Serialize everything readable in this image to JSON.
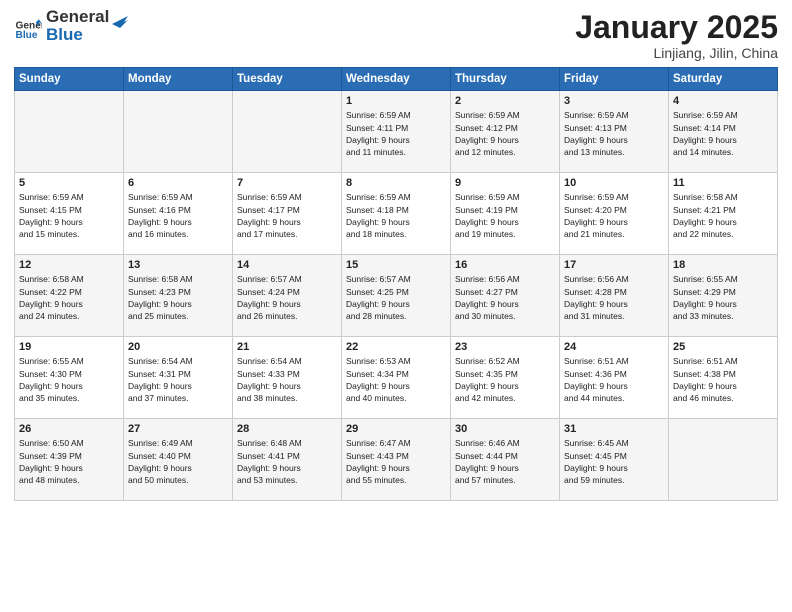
{
  "header": {
    "logo_general": "General",
    "logo_blue": "Blue",
    "month": "January 2025",
    "location": "Linjiang, Jilin, China"
  },
  "weekdays": [
    "Sunday",
    "Monday",
    "Tuesday",
    "Wednesday",
    "Thursday",
    "Friday",
    "Saturday"
  ],
  "weeks": [
    [
      {
        "day": "",
        "info": ""
      },
      {
        "day": "",
        "info": ""
      },
      {
        "day": "",
        "info": ""
      },
      {
        "day": "1",
        "info": "Sunrise: 6:59 AM\nSunset: 4:11 PM\nDaylight: 9 hours\nand 11 minutes."
      },
      {
        "day": "2",
        "info": "Sunrise: 6:59 AM\nSunset: 4:12 PM\nDaylight: 9 hours\nand 12 minutes."
      },
      {
        "day": "3",
        "info": "Sunrise: 6:59 AM\nSunset: 4:13 PM\nDaylight: 9 hours\nand 13 minutes."
      },
      {
        "day": "4",
        "info": "Sunrise: 6:59 AM\nSunset: 4:14 PM\nDaylight: 9 hours\nand 14 minutes."
      }
    ],
    [
      {
        "day": "5",
        "info": "Sunrise: 6:59 AM\nSunset: 4:15 PM\nDaylight: 9 hours\nand 15 minutes."
      },
      {
        "day": "6",
        "info": "Sunrise: 6:59 AM\nSunset: 4:16 PM\nDaylight: 9 hours\nand 16 minutes."
      },
      {
        "day": "7",
        "info": "Sunrise: 6:59 AM\nSunset: 4:17 PM\nDaylight: 9 hours\nand 17 minutes."
      },
      {
        "day": "8",
        "info": "Sunrise: 6:59 AM\nSunset: 4:18 PM\nDaylight: 9 hours\nand 18 minutes."
      },
      {
        "day": "9",
        "info": "Sunrise: 6:59 AM\nSunset: 4:19 PM\nDaylight: 9 hours\nand 19 minutes."
      },
      {
        "day": "10",
        "info": "Sunrise: 6:59 AM\nSunset: 4:20 PM\nDaylight: 9 hours\nand 21 minutes."
      },
      {
        "day": "11",
        "info": "Sunrise: 6:58 AM\nSunset: 4:21 PM\nDaylight: 9 hours\nand 22 minutes."
      }
    ],
    [
      {
        "day": "12",
        "info": "Sunrise: 6:58 AM\nSunset: 4:22 PM\nDaylight: 9 hours\nand 24 minutes."
      },
      {
        "day": "13",
        "info": "Sunrise: 6:58 AM\nSunset: 4:23 PM\nDaylight: 9 hours\nand 25 minutes."
      },
      {
        "day": "14",
        "info": "Sunrise: 6:57 AM\nSunset: 4:24 PM\nDaylight: 9 hours\nand 26 minutes."
      },
      {
        "day": "15",
        "info": "Sunrise: 6:57 AM\nSunset: 4:25 PM\nDaylight: 9 hours\nand 28 minutes."
      },
      {
        "day": "16",
        "info": "Sunrise: 6:56 AM\nSunset: 4:27 PM\nDaylight: 9 hours\nand 30 minutes."
      },
      {
        "day": "17",
        "info": "Sunrise: 6:56 AM\nSunset: 4:28 PM\nDaylight: 9 hours\nand 31 minutes."
      },
      {
        "day": "18",
        "info": "Sunrise: 6:55 AM\nSunset: 4:29 PM\nDaylight: 9 hours\nand 33 minutes."
      }
    ],
    [
      {
        "day": "19",
        "info": "Sunrise: 6:55 AM\nSunset: 4:30 PM\nDaylight: 9 hours\nand 35 minutes."
      },
      {
        "day": "20",
        "info": "Sunrise: 6:54 AM\nSunset: 4:31 PM\nDaylight: 9 hours\nand 37 minutes."
      },
      {
        "day": "21",
        "info": "Sunrise: 6:54 AM\nSunset: 4:33 PM\nDaylight: 9 hours\nand 38 minutes."
      },
      {
        "day": "22",
        "info": "Sunrise: 6:53 AM\nSunset: 4:34 PM\nDaylight: 9 hours\nand 40 minutes."
      },
      {
        "day": "23",
        "info": "Sunrise: 6:52 AM\nSunset: 4:35 PM\nDaylight: 9 hours\nand 42 minutes."
      },
      {
        "day": "24",
        "info": "Sunrise: 6:51 AM\nSunset: 4:36 PM\nDaylight: 9 hours\nand 44 minutes."
      },
      {
        "day": "25",
        "info": "Sunrise: 6:51 AM\nSunset: 4:38 PM\nDaylight: 9 hours\nand 46 minutes."
      }
    ],
    [
      {
        "day": "26",
        "info": "Sunrise: 6:50 AM\nSunset: 4:39 PM\nDaylight: 9 hours\nand 48 minutes."
      },
      {
        "day": "27",
        "info": "Sunrise: 6:49 AM\nSunset: 4:40 PM\nDaylight: 9 hours\nand 50 minutes."
      },
      {
        "day": "28",
        "info": "Sunrise: 6:48 AM\nSunset: 4:41 PM\nDaylight: 9 hours\nand 53 minutes."
      },
      {
        "day": "29",
        "info": "Sunrise: 6:47 AM\nSunset: 4:43 PM\nDaylight: 9 hours\nand 55 minutes."
      },
      {
        "day": "30",
        "info": "Sunrise: 6:46 AM\nSunset: 4:44 PM\nDaylight: 9 hours\nand 57 minutes."
      },
      {
        "day": "31",
        "info": "Sunrise: 6:45 AM\nSunset: 4:45 PM\nDaylight: 9 hours\nand 59 minutes."
      },
      {
        "day": "",
        "info": ""
      }
    ]
  ]
}
